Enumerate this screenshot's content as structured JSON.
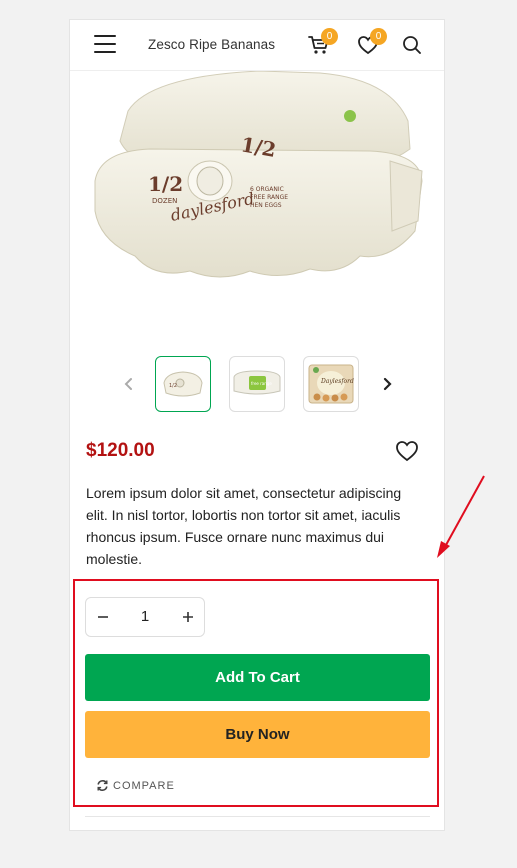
{
  "header": {
    "title": "Zesco Ripe Bananas",
    "cart_count": "0",
    "wishlist_count": "0"
  },
  "product": {
    "price": "$120.00",
    "description": "Lorem ipsum dolor sit amet, consectetur adipiscing elit. In nisl tortor, lobortis non tortor sit amet, iaculis rhoncus ipsum. Fusce ornare nunc maximus dui molestie.",
    "image_text": {
      "big_number": "1/2",
      "dozen": "DOZEN",
      "brand": "daylesford"
    },
    "thumbnail_labels": [
      "",
      "free range",
      "Daylesford"
    ]
  },
  "purchase": {
    "quantity": "1",
    "add_to_cart_label": "Add To Cart",
    "buy_now_label": "Buy Now",
    "compare_label": "COMPARE"
  },
  "colors": {
    "price": "#b31212",
    "add_to_cart": "#00a651",
    "buy_now": "#ffb33b",
    "badge": "#f5a623",
    "annotation": "#e00d1f"
  },
  "icons": [
    "menu-icon",
    "cart-icon",
    "heart-icon",
    "search-icon",
    "chevron-left-icon",
    "chevron-right-icon",
    "minus-icon",
    "plus-icon",
    "refresh-icon"
  ]
}
